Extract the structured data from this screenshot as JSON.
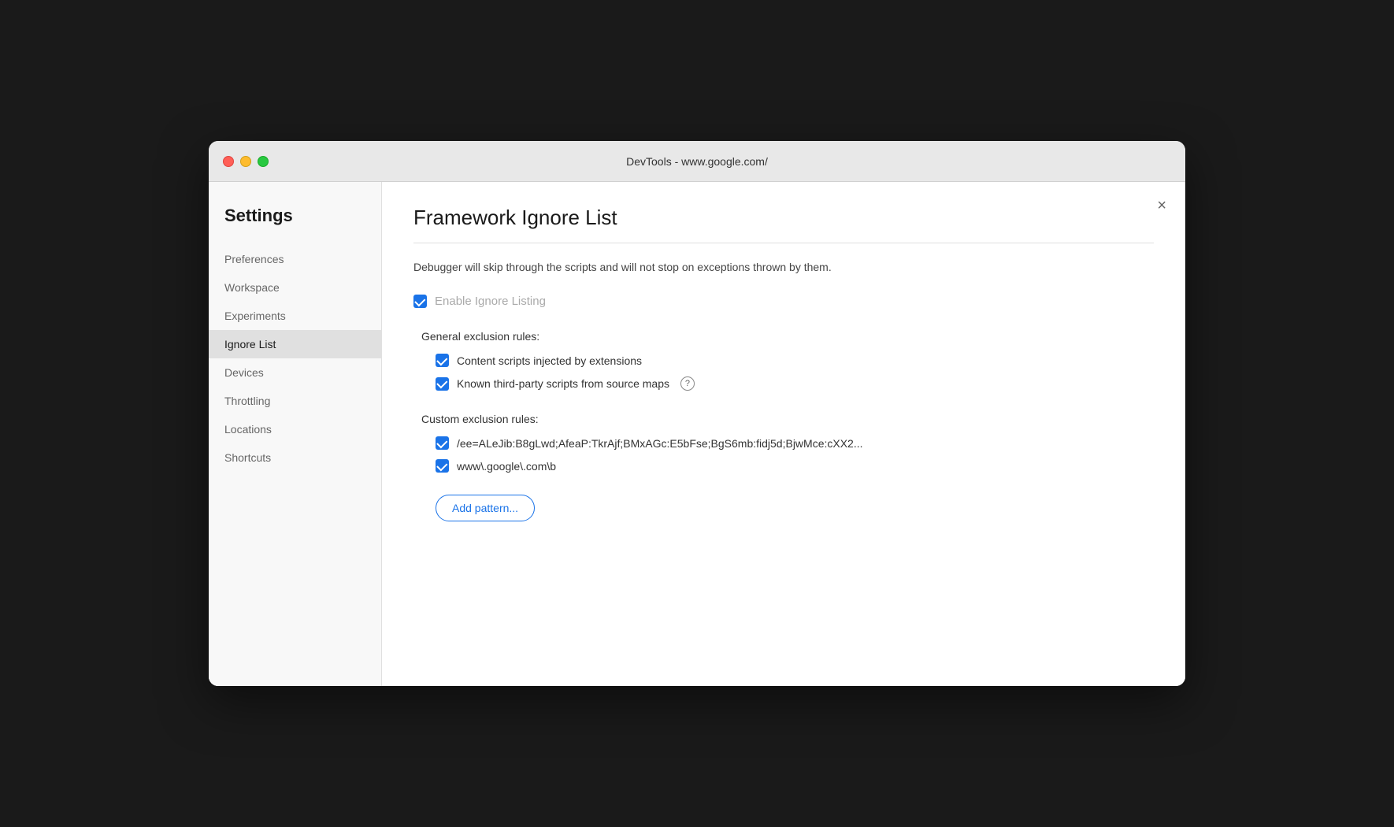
{
  "window": {
    "title": "DevTools - www.google.com/"
  },
  "sidebar": {
    "heading": "Settings",
    "items": [
      {
        "id": "preferences",
        "label": "Preferences",
        "active": false
      },
      {
        "id": "workspace",
        "label": "Workspace",
        "active": false
      },
      {
        "id": "experiments",
        "label": "Experiments",
        "active": false
      },
      {
        "id": "ignore-list",
        "label": "Ignore List",
        "active": true
      },
      {
        "id": "devices",
        "label": "Devices",
        "active": false
      },
      {
        "id": "throttling",
        "label": "Throttling",
        "active": false
      },
      {
        "id": "locations",
        "label": "Locations",
        "active": false
      },
      {
        "id": "shortcuts",
        "label": "Shortcuts",
        "active": false
      }
    ]
  },
  "main": {
    "title": "Framework Ignore List",
    "description": "Debugger will skip through the scripts and will not stop on exceptions thrown by them.",
    "enable_ignore_listing_label": "Enable Ignore Listing",
    "general_exclusion_label": "General exclusion rules:",
    "general_rules": [
      {
        "id": "content-scripts",
        "label": "Content scripts injected by extensions",
        "checked": true,
        "has_help": false
      },
      {
        "id": "third-party-scripts",
        "label": "Known third-party scripts from source maps",
        "checked": true,
        "has_help": true
      }
    ],
    "custom_exclusion_label": "Custom exclusion rules:",
    "custom_rules": [
      {
        "id": "custom-rule-1",
        "label": "/ee=ALeJib:B8gLwd;AfeaP:TkrAjf;BMxAGc:E5bFse;BgS6mb:fidj5d;BjwMce:cXX2...",
        "checked": true
      },
      {
        "id": "custom-rule-2",
        "label": "www\\.google\\.com\\b",
        "checked": true
      }
    ],
    "add_pattern_label": "Add pattern..."
  },
  "close_button_label": "×"
}
